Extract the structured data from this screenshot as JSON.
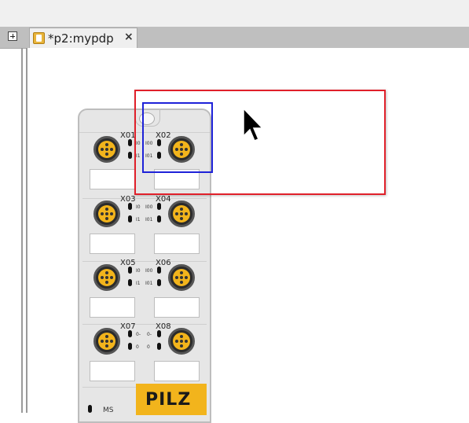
{
  "editor": {
    "tab": {
      "label": "*p2:mypdp",
      "close": "×"
    }
  },
  "device": {
    "brand": "PILZ",
    "ms_label": "MS",
    "connectors": [
      {
        "label": "X01",
        "io_a": "I0",
        "io_b": "I1"
      },
      {
        "label": "X02",
        "io_a": "I00",
        "io_b": "I01"
      },
      {
        "label": "X03",
        "io_a": "I0",
        "io_b": "I1"
      },
      {
        "label": "X04",
        "io_a": "I00",
        "io_b": "I01"
      },
      {
        "label": "X05",
        "io_a": "I0",
        "io_b": "I1"
      },
      {
        "label": "X06",
        "io_a": "I00",
        "io_b": "I01"
      },
      {
        "label": "X07",
        "io_a": "0-",
        "io_b": "0"
      },
      {
        "label": "X08",
        "io_a": "0-",
        "io_b": "0"
      }
    ]
  }
}
